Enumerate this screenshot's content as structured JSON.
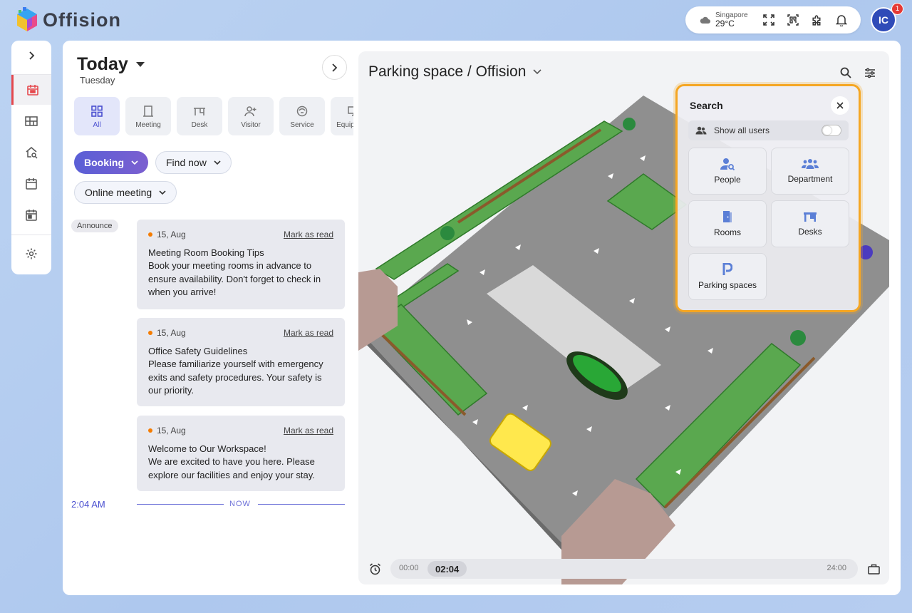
{
  "app": {
    "name": "Offision"
  },
  "topbar": {
    "weather_city": "Singapore",
    "weather_temp": "29°C",
    "avatar_initials": "IC",
    "notification_count": "1"
  },
  "left": {
    "title": "Today",
    "day": "Tuesday",
    "categories": [
      {
        "label": "All",
        "icon": "grid-icon"
      },
      {
        "label": "Meeting",
        "icon": "door-icon"
      },
      {
        "label": "Desk",
        "icon": "desk-icon"
      },
      {
        "label": "Visitor",
        "icon": "person-add-icon"
      },
      {
        "label": "Service",
        "icon": "service-icon"
      },
      {
        "label": "Equipment",
        "icon": "monitor-icon"
      }
    ],
    "filters": {
      "booking": "Booking",
      "find_now": "Find now",
      "online_meeting": "Online meeting"
    },
    "announce_tag": "Announce",
    "notices": [
      {
        "date": "15, Aug",
        "action": "Mark as read",
        "title": "Meeting Room Booking Tips",
        "body": "Book your meeting rooms in advance to ensure availability. Don't forget to check in when you arrive!"
      },
      {
        "date": "15, Aug",
        "action": "Mark as read",
        "title": "Office Safety Guidelines",
        "body": "Please familiarize yourself with emergency exits and safety procedures. Your safety is our priority."
      },
      {
        "date": "15, Aug",
        "action": "Mark as read",
        "title": "Welcome to Our Workspace!",
        "body": "We are excited to have you here. Please explore our facilities and enjoy your stay."
      }
    ],
    "timeline": {
      "time": "2:04 AM",
      "now_label": "NOW"
    }
  },
  "map": {
    "title": "Parking space / Offision"
  },
  "search_panel": {
    "title": "Search",
    "toggle_label": "Show all users",
    "toggle_on": false,
    "tiles": [
      {
        "label": "People",
        "icon": "people-search-icon"
      },
      {
        "label": "Department",
        "icon": "department-icon"
      },
      {
        "label": "Rooms",
        "icon": "door-icon"
      },
      {
        "label": "Desks",
        "icon": "desk-icon"
      },
      {
        "label": "Parking spaces",
        "icon": "parking-icon"
      }
    ]
  },
  "time_slider": {
    "start": "00:00",
    "current": "02:04",
    "end": "24:00"
  },
  "colors": {
    "accent": "#4a4fd0",
    "highlight": "#f5a623",
    "parking_green": "#5aa84f",
    "active_nav": "#e5484d"
  }
}
